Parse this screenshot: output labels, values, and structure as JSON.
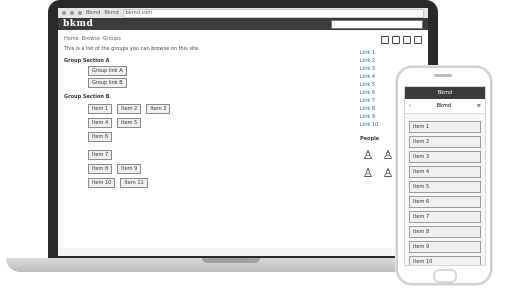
{
  "browser": {
    "tabs": [
      "Bkmd",
      "Bkmd"
    ],
    "address": "bkmd.com"
  },
  "app": {
    "logo": "bkmd"
  },
  "page": {
    "breadcrumb": [
      "Home",
      "Browse",
      "Groups"
    ],
    "lead": "This is a list of the groups you can browse on this site.",
    "section1": {
      "title": "Group Section A",
      "items": [
        "Group link A",
        "Group link B"
      ]
    },
    "section2": {
      "title": "Group Section B",
      "rows": [
        [
          "Item 1",
          "Item 2",
          "Item 3"
        ],
        [
          "Item 4",
          "Item 5"
        ],
        [
          "Item 6"
        ]
      ],
      "subrows": [
        [
          "Item 7"
        ],
        [
          "Item 8",
          "Item 9"
        ],
        [
          "Item 10",
          "Item 11"
        ]
      ]
    }
  },
  "sidebar": {
    "links": [
      "Link 1",
      "Link 2",
      "Link 3",
      "Link 4",
      "Link 5",
      "Link 6",
      "Link 7",
      "Link 8",
      "Link 9",
      "Link 10"
    ],
    "people_label": "People",
    "people_icons": [
      "user-icon",
      "user-icon",
      "user-icon",
      "user-icon",
      "user-icon",
      "user-icon"
    ]
  },
  "phone": {
    "status": "Bkmd",
    "header": "Bkmd",
    "items": [
      "Item 1",
      "Item 2",
      "Item 3",
      "Item 4",
      "Item 5",
      "Item 6",
      "Item 7",
      "Item 8",
      "Item 9",
      "Item 10"
    ]
  }
}
